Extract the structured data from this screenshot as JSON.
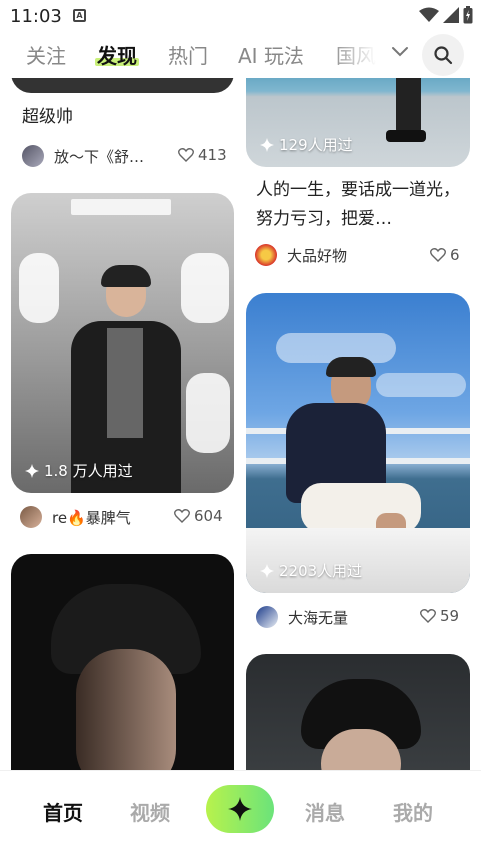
{
  "status_bar": {
    "time": "11:03"
  },
  "tabs": [
    {
      "label": "关注"
    },
    {
      "label": "发现",
      "active": true
    },
    {
      "label": "热门"
    },
    {
      "label": "AI 玩法"
    },
    {
      "label": "国风"
    }
  ],
  "feed": {
    "left": [
      {
        "title": "超级帅",
        "user": "放～下《舒…",
        "likes": "413"
      },
      {
        "usage": "1.8 万人用过",
        "user": "re🔥暴脾气",
        "likes": "604"
      },
      {}
    ],
    "right": [
      {
        "usage": "129人用过",
        "title": "人的一生，要话成一道光，努力亏习，把爱…",
        "user": "大品好物",
        "likes": "6"
      },
      {
        "usage": "2203人用过",
        "user": "大海无量",
        "likes": "59"
      },
      {}
    ]
  },
  "bottom_nav": [
    {
      "label": "首页",
      "active": true
    },
    {
      "label": "视频"
    },
    {
      "label": "消息"
    },
    {
      "label": "我的"
    }
  ],
  "colors": {
    "accent_green": "#c9f07a",
    "create_gradient_start": "#b8f24c",
    "create_gradient_end": "#6be37a"
  }
}
